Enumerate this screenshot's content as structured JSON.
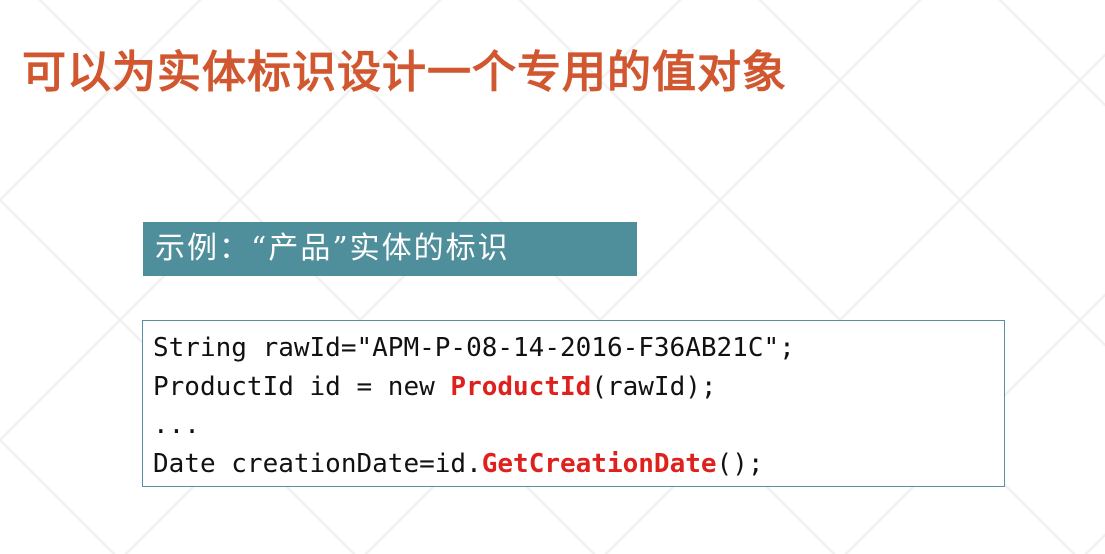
{
  "slide": {
    "title": "可以为实体标识设计一个专用的值对象"
  },
  "example": {
    "label": "示例：“产品”实体的标识"
  },
  "code": {
    "line1": "String rawId=\"APM-P-08-14-2016-F36AB21C\";",
    "line2_pre": "ProductId id = new ",
    "line2_highlight": "ProductId",
    "line2_post": "(rawId);",
    "line3": "...",
    "line4_pre": "Date creationDate=id.",
    "line4_highlight": "GetCreationDate",
    "line4_post": "();"
  },
  "colors": {
    "title": "#d0572f",
    "banner_bg": "#4f8e9b",
    "code_highlight": "#e0201c",
    "code_border": "#5a8fa0"
  }
}
